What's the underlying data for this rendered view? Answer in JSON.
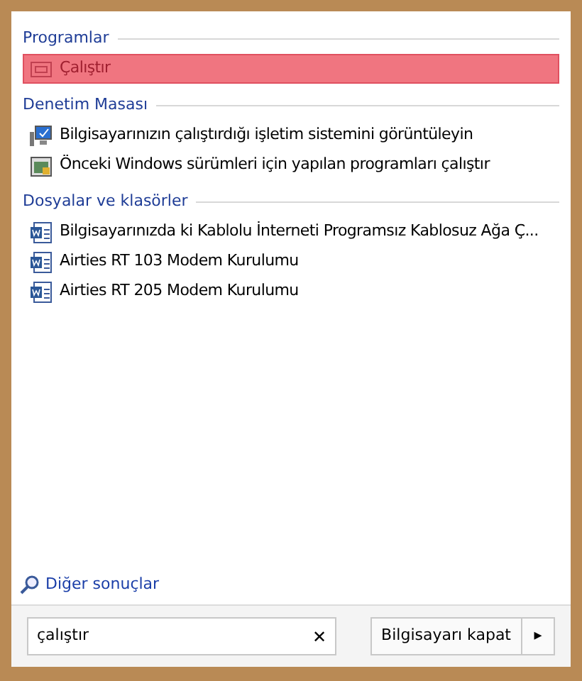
{
  "sections": [
    {
      "title": "Programlar",
      "items": [
        {
          "label": "Çalıştır",
          "kind": "run",
          "selected": true
        }
      ]
    },
    {
      "title": "Denetim Masası",
      "items": [
        {
          "label": "Bilgisayarınızın çalıştırdığı işletim sistemini görüntüleyin",
          "kind": "monitor",
          "selected": false
        },
        {
          "label": "Önceki Windows sürümleri için yapılan programları çalıştır",
          "kind": "compat",
          "selected": false
        }
      ]
    },
    {
      "title": "Dosyalar ve klasörler",
      "items": [
        {
          "label": "Bilgisayarınızda ki Kablolu İnterneti Programsız Kablosuz Ağa Ç...",
          "kind": "document",
          "selected": false
        },
        {
          "label": "Airties RT 103 Modem Kurulumu",
          "kind": "document",
          "selected": false
        },
        {
          "label": "Airties RT 205 Modem Kurulumu",
          "kind": "document",
          "selected": false
        }
      ]
    }
  ],
  "more_results": "Diğer sonuçlar",
  "search": {
    "value": "çalıştır",
    "clear": "✕"
  },
  "shutdown": {
    "label": "Bilgisayarı kapat",
    "arrow": "▸"
  }
}
